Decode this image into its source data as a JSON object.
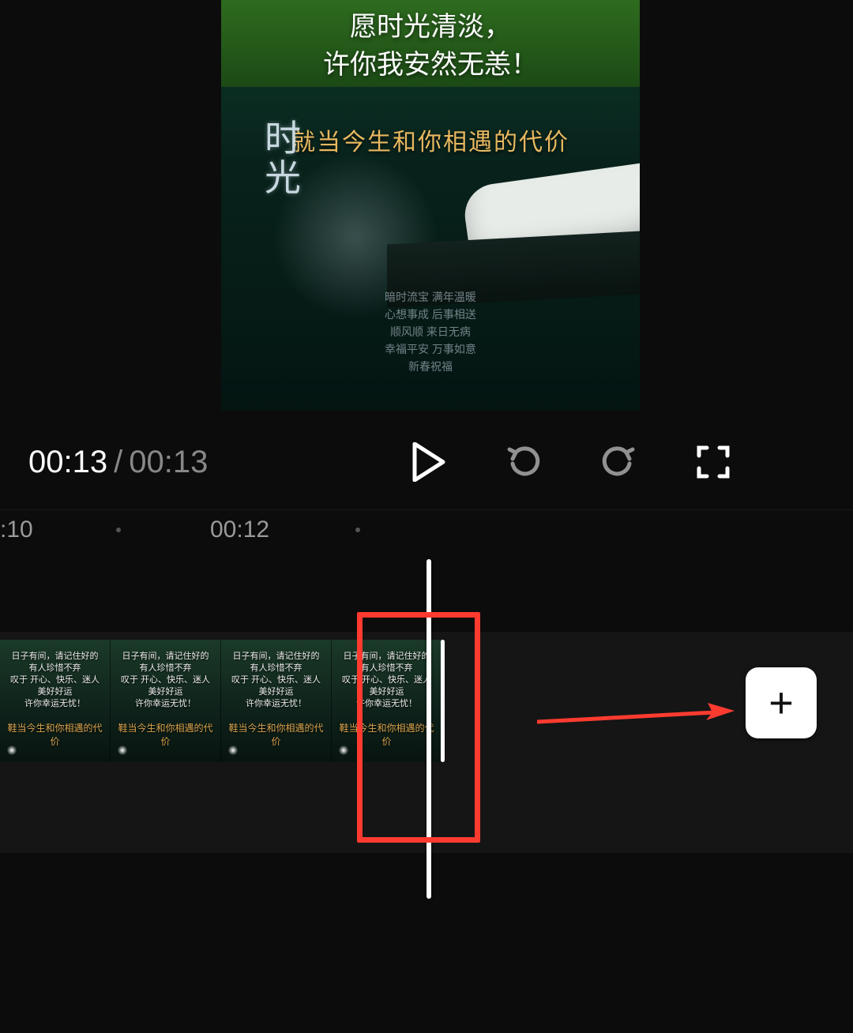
{
  "preview": {
    "poem_line1": "愿时光清淡，",
    "poem_line2": "许你我安然无恙！",
    "lyric": "就当今生和你相遇的代价",
    "title_chars": "时\n光",
    "credits": "暗时流宝 满年温暖\n心想事成 后事相送\n顺风顺 来日无病\n幸福平安 万事如意\n新春祝福"
  },
  "transport": {
    "current_time": "00:13",
    "separator": "/",
    "duration": "00:13"
  },
  "ruler": {
    "label_left": ":10",
    "label_right": "00:12"
  },
  "timeline": {
    "thumb_overlay_top": "日子有间，请记住好的\n有人珍惜不弃\n叹于 开心、快乐、迷人\n美好好运\n许你幸运无忧！",
    "thumb_overlay_bottom": "鞋当今生和你相遇的代价",
    "add_label": "+"
  }
}
